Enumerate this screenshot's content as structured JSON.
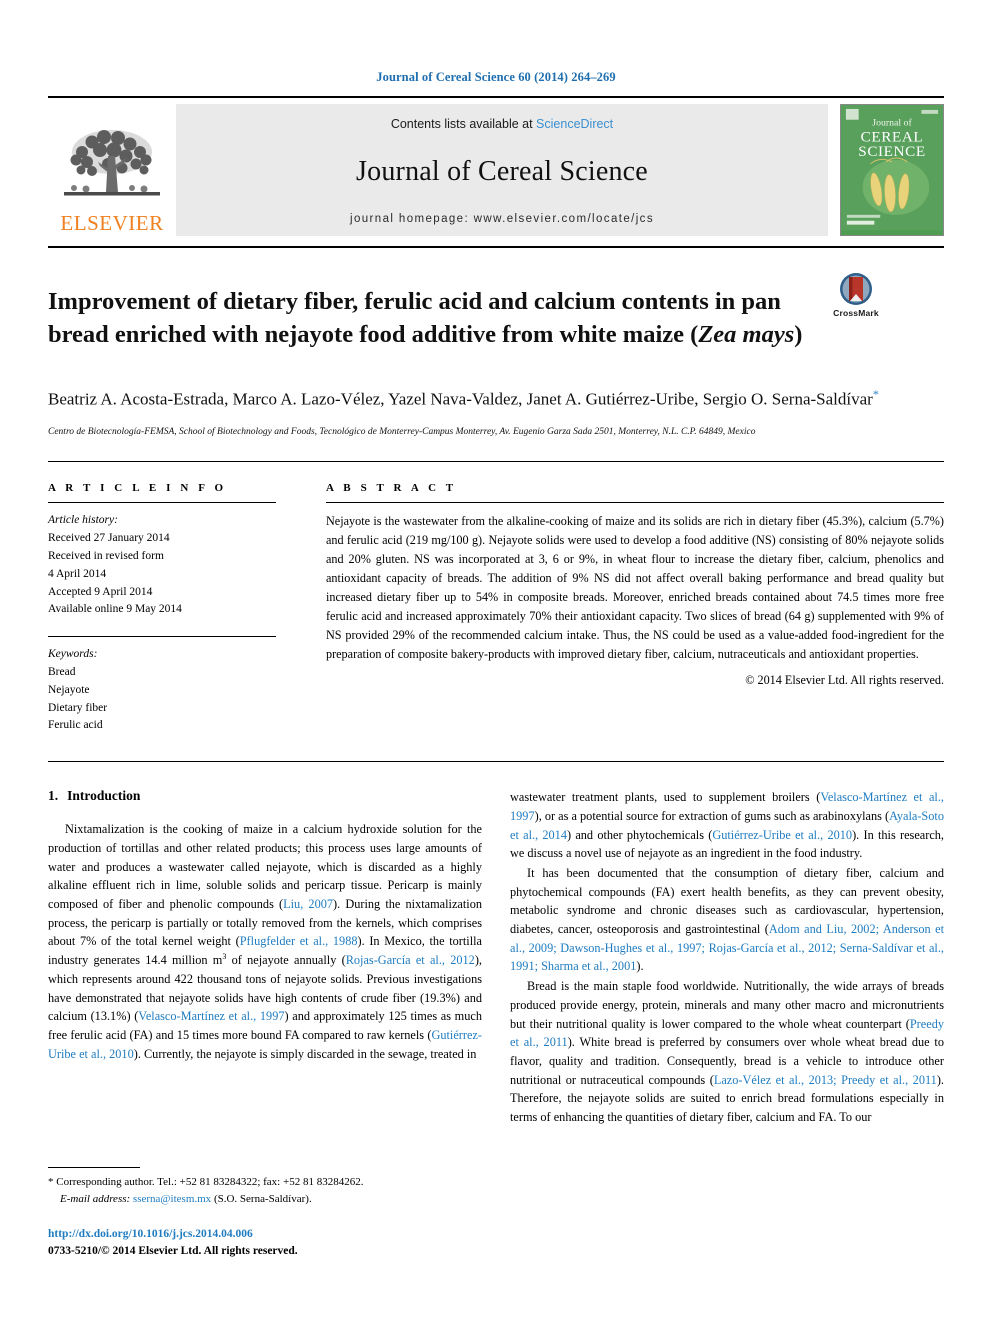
{
  "running_head": "Journal of Cereal Science 60 (2014) 264–269",
  "masthead": {
    "contents_prefix": "Contents lists available at ",
    "sciencedirect": "ScienceDirect",
    "journal_title": "Journal of Cereal Science",
    "homepage": "journal homepage: www.elsevier.com/locate/jcs",
    "publisher_name": "ELSEVIER",
    "publisher_logo_icon": "elsevier-tree-icon",
    "cover_title_line1": "Journal of",
    "cover_title_line2": "CEREAL",
    "cover_title_line3": "SCIENCE",
    "link_color": "#3a8fd0",
    "band_color": "#eaeaea",
    "elsevier_orange": "#f08021",
    "cover_green": "#4e9d52"
  },
  "article": {
    "title_part1": "Improvement of dietary fiber, ferulic acid and calcium contents in pan bread enriched with nejayote food additive from white maize (",
    "title_italic": "Zea mays",
    "title_part2": ")",
    "crossmark_label": "CrossMark",
    "crossmark_icon": "crossmark-badge-icon",
    "authors": "Beatriz A. Acosta-Estrada, Marco A. Lazo-Vélez, Yazel Nava-Valdez, Janet A. Gutiérrez-Uribe, Sergio O. Serna-Saldívar",
    "author_star": "*",
    "affiliation": "Centro de Biotecnología-FEMSA, School of Biotechnology and Foods, Tecnológico de Monterrey-Campus Monterrey, Av. Eugenio Garza Sada 2501, Monterrey, N.L. C.P. 64849, Mexico"
  },
  "article_info": {
    "heading": "A R T I C L E   I N F O",
    "history_label": "Article history:",
    "history": [
      "Received 27 January 2014",
      "Received in revised form",
      "4 April 2014",
      "Accepted 9 April 2014",
      "Available online 9 May 2014"
    ],
    "keywords_label": "Keywords:",
    "keywords": [
      "Bread",
      "Nejayote",
      "Dietary fiber",
      "Ferulic acid"
    ]
  },
  "abstract": {
    "heading": "A B S T R A C T",
    "text": "Nejayote is the wastewater from the alkaline-cooking of maize and its solids are rich in dietary fiber (45.3%), calcium (5.7%) and ferulic acid (219 mg/100 g). Nejayote solids were used to develop a food additive (NS) consisting of 80% nejayote solids and 20% gluten. NS was incorporated at 3, 6 or 9%, in wheat flour to increase the dietary fiber, calcium, phenolics and antioxidant capacity of breads. The addition of 9% NS did not affect overall baking performance and bread quality but increased dietary fiber up to 54% in composite breads. Moreover, enriched breads contained about 74.5 times more free ferulic acid and increased approximately 70% their antioxidant capacity. Two slices of bread (64 g) supplemented with 9% of NS provided 29% of the recommended calcium intake. Thus, the NS could be used as a value-added food-ingredient for the preparation of composite bakery-products with improved dietary fiber, calcium, nutraceuticals and antioxidant properties.",
    "copyright": "© 2014 Elsevier Ltd. All rights reserved."
  },
  "body": {
    "section_number": "1.",
    "section_title": "Introduction",
    "left_paragraph_1": {
      "s1": "Nixtamalization is the cooking of maize in a calcium hydroxide solution for the production of tortillas and other related products; this process uses large amounts of water and produces a wastewater called nejayote, which is discarded as a highly alkaline effluent rich in lime, soluble solids and pericarp tissue. Pericarp is mainly composed of fiber and phenolic compounds (",
      "c1": "Liu, 2007",
      "s2": "). During the nixtamalization process, the pericarp is partially or totally removed from the kernels, which comprises about 7% of the total kernel weight (",
      "c2": "Pflugfelder et al., 1988",
      "s3": "). In Mexico, the tortilla industry generates 14.4 million m",
      "sup": "3",
      "s4": " of nejayote annually (",
      "c3": "Rojas-García et al., 2012",
      "s5": "), which represents around 422 thousand tons of nejayote solids. Previous investigations have demonstrated that nejayote solids have high contents of crude fiber (19.3%) and calcium (13.1%) (",
      "c4": "Velasco-Martínez et al., 1997",
      "s6": ") and approximately 125 times as much free ferulic acid (FA) and 15 times more bound FA compared to raw kernels (",
      "c5": "Gutiérrez-Uribe et al., 2010",
      "s7": "). Currently, the nejayote is simply discarded in the sewage, treated in"
    },
    "right_paragraph_1": {
      "s1": "wastewater treatment plants, used to supplement broilers (",
      "c1": "Velasco-Martínez et al., 1997",
      "s2": "), or as a potential source for extraction of gums such as arabinoxylans (",
      "c2": "Ayala-Soto et al., 2014",
      "s3": ") and other phytochemicals (",
      "c3": "Gutiérrez-Uribe et al., 2010",
      "s4": "). In this research, we discuss a novel use of nejayote as an ingredient in the food industry."
    },
    "right_paragraph_2": {
      "s1": "It has been documented that the consumption of dietary fiber, calcium and phytochemical compounds (FA) exert health benefits, as they can prevent obesity, metabolic syndrome and chronic diseases such as cardiovascular, hypertension, diabetes, cancer, osteoporosis and gastrointestinal (",
      "c1": "Adom and Liu, 2002; Anderson et al., 2009; Dawson-Hughes et al., 1997; Rojas-García et al., 2012; Serna-Saldívar et al., 1991; Sharma et al., 2001",
      "s2": ")."
    },
    "right_paragraph_3": {
      "s1": "Bread is the main staple food worldwide. Nutritionally, the wide arrays of breads produced provide energy, protein, minerals and many other macro and micronutrients but their nutritional quality is lower compared to the whole wheat counterpart (",
      "c1": "Preedy et al., 2011",
      "s2": "). White bread is preferred by consumers over whole wheat bread due to flavor, quality and tradition. Consequently, bread is a vehicle to introduce other nutritional or nutraceutical compounds (",
      "c2": "Lazo-Vélez et al., 2013; Preedy et al., 2011",
      "s3": "). Therefore, the nejayote solids are suited to enrich bread formulations especially in terms of enhancing the quantities of dietary fiber, calcium and FA. To our"
    }
  },
  "footer": {
    "corresponding_star": "*",
    "corresponding_text": "Corresponding author. Tel.: +52 81 83284322; fax: +52 81 83284262.",
    "email_label": "E-mail address:",
    "email": "sserna@itesm.mx",
    "email_suffix": "(S.O. Serna-Saldívar).",
    "doi_url": "http://dx.doi.org/10.1016/j.jcs.2014.04.006",
    "issn_line": "0733-5210/© 2014 Elsevier Ltd. All rights reserved."
  }
}
